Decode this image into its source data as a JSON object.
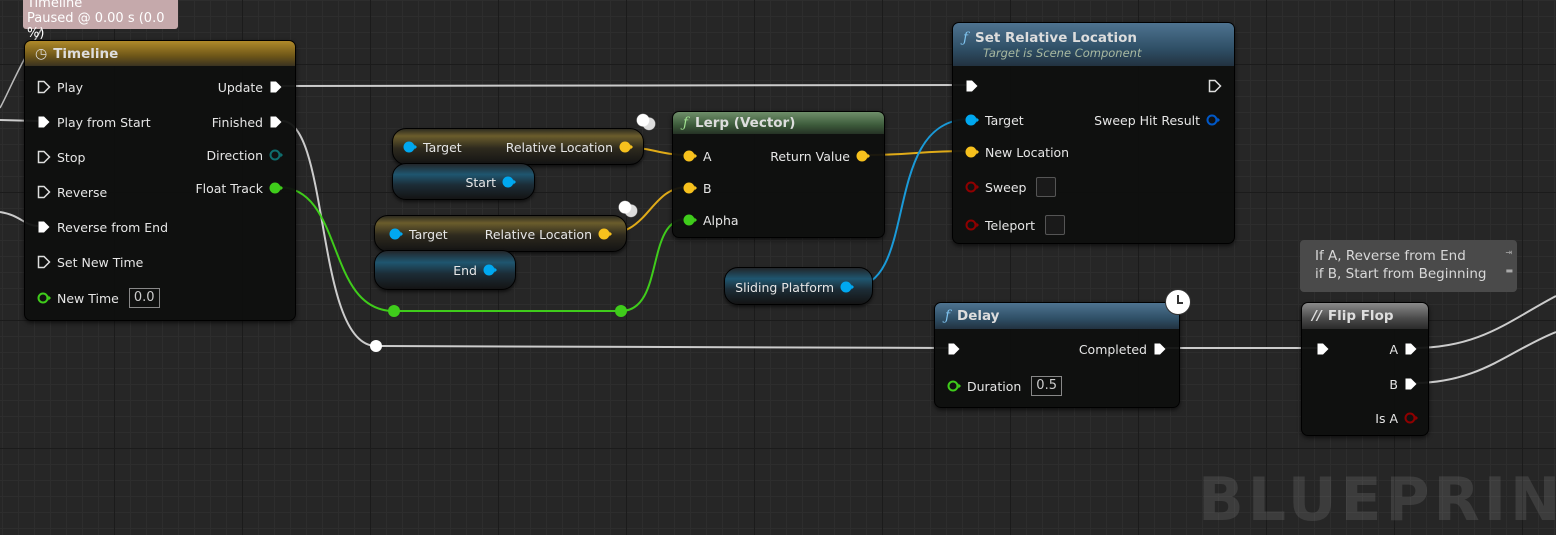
{
  "timeline_tooltip": {
    "title": "Timeline",
    "status": "Paused @ 0.00 s (0.0 %)"
  },
  "timeline": {
    "title": "Timeline",
    "inputs": [
      "Play",
      "Play from Start",
      "Stop",
      "Reverse",
      "Reverse from End",
      "Set New Time"
    ],
    "new_time_label": "New Time",
    "new_time_value": "0.0",
    "outputs": [
      "Update",
      "Finished",
      "Direction",
      "Float Track"
    ]
  },
  "get_start": {
    "target": "Target",
    "output": "Relative Location",
    "var": "Start"
  },
  "get_end": {
    "target": "Target",
    "output": "Relative Location",
    "var": "End"
  },
  "lerp": {
    "title": "Lerp (Vector)",
    "a": "A",
    "b": "B",
    "alpha": "Alpha",
    "return": "Return Value"
  },
  "set_rel": {
    "title": "Set Relative Location",
    "subtitle": "Target is Scene Component",
    "target": "Target",
    "new_location": "New Location",
    "sweep": "Sweep",
    "teleport": "Teleport",
    "sweep_hit": "Sweep Hit Result"
  },
  "sliding_platform": {
    "label": "Sliding Platform"
  },
  "delay": {
    "title": "Delay",
    "completed": "Completed",
    "duration_label": "Duration",
    "duration_value": "0.5"
  },
  "comment": {
    "line1": "If A, Reverse from End",
    "line2": "if B, Start from Beginning"
  },
  "flipflop": {
    "title": "Flip Flop",
    "a": "A",
    "b": "B",
    "is_a": "Is A"
  },
  "watermark": "BLUEPRINT",
  "colors": {
    "exec": "#ffffff",
    "vector": "#f7c11d",
    "object": "#00a8f0",
    "float": "#3fcc1b",
    "bool": "#8f0000",
    "struct": "#0058c8",
    "direction": "#0f5e5e"
  }
}
